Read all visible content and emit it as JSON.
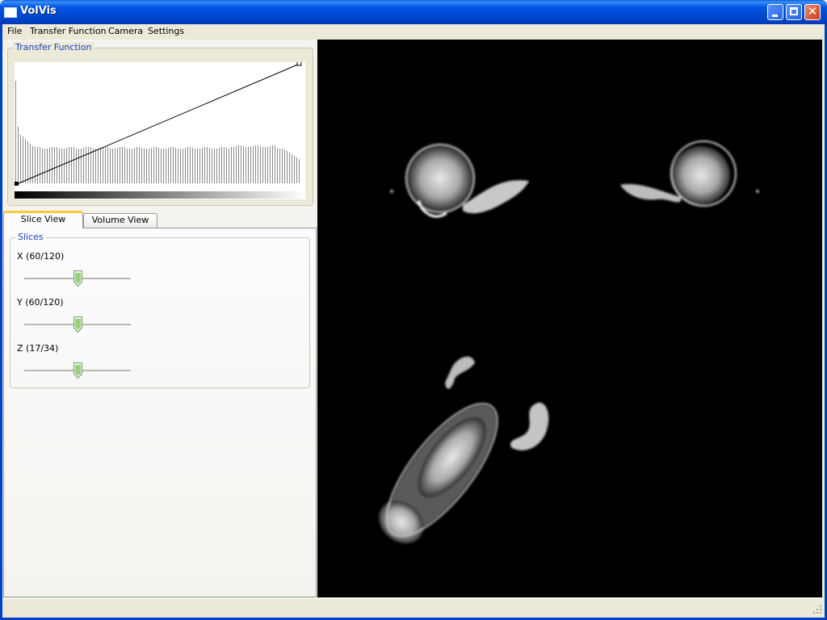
{
  "window": {
    "title": "VolVis"
  },
  "menu": {
    "items": [
      "File",
      "Transfer Function",
      "Camera",
      "Settings"
    ]
  },
  "transfer_function": {
    "group_title": "Transfer Function"
  },
  "tabs": {
    "slice_view": "Slice View",
    "volume_view": "Volume View"
  },
  "slices": {
    "group_title": "Slices",
    "x": {
      "label": "X (60/120)",
      "value": 60,
      "max": 120
    },
    "y": {
      "label": "Y (60/120)",
      "value": 60,
      "max": 120
    },
    "z": {
      "label": "Z (17/34)",
      "value": 17,
      "max": 34
    }
  },
  "colors": {
    "title_bar": "#0055e5",
    "group_title": "#1c44b8",
    "viewport_bg": "#000000",
    "active_tab_accent": "#ffc83c"
  }
}
